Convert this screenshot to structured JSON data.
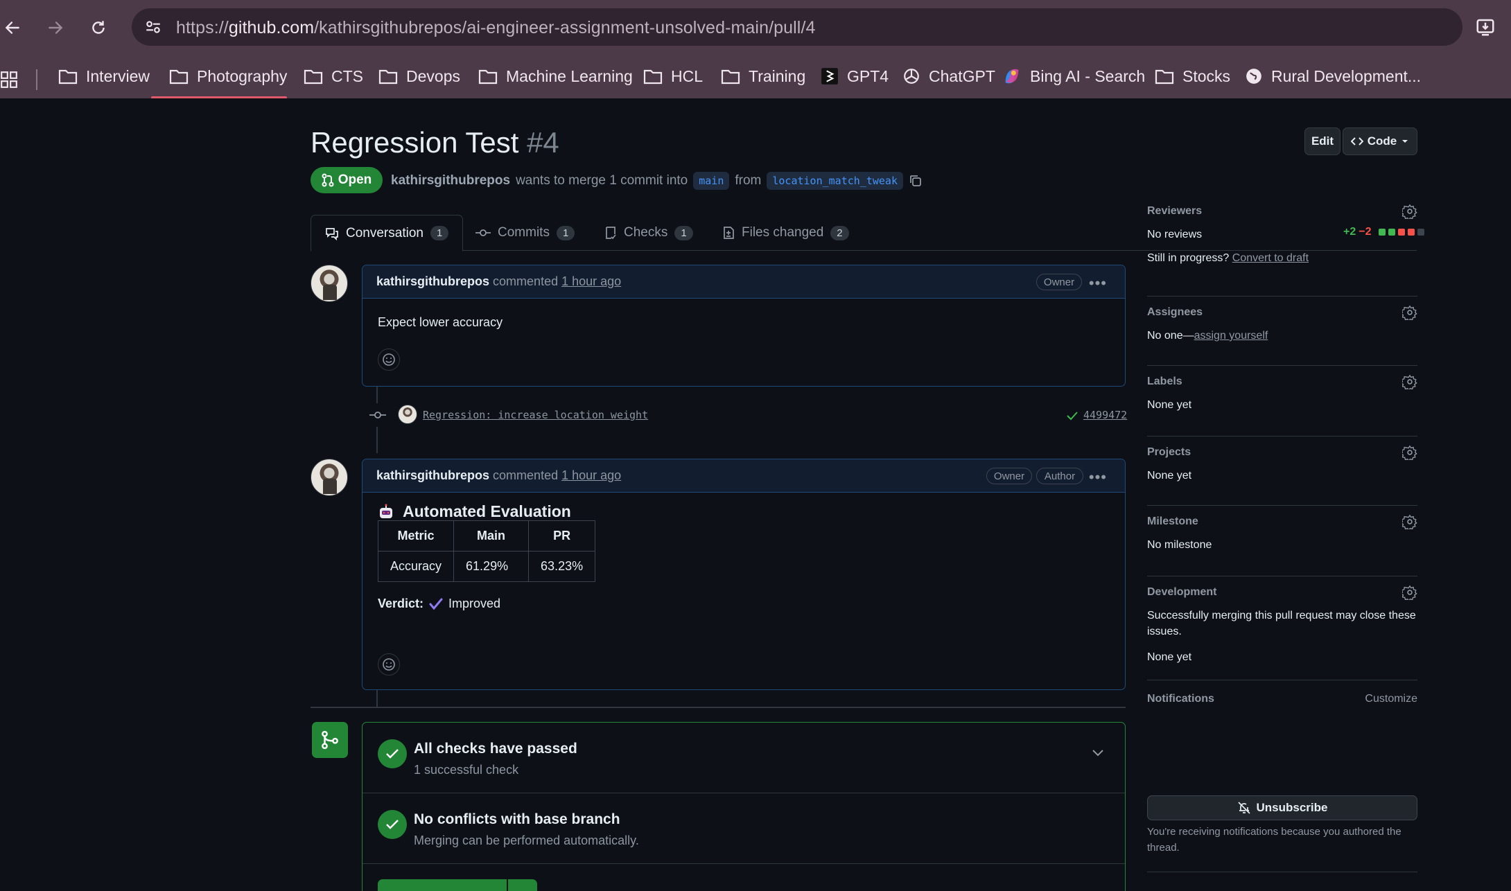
{
  "browser": {
    "url_prefix": "https://",
    "url_host": "github.com",
    "url_path": "/kathirsgithubrepos/ai-engineer-assignment-unsolved-main/pull/4",
    "bookmarks": [
      {
        "label": "Interview"
      },
      {
        "label": "Photography"
      },
      {
        "label": "CTS"
      },
      {
        "label": "Devops"
      },
      {
        "label": "Machine Learning"
      },
      {
        "label": "HCL"
      },
      {
        "label": "Training"
      },
      {
        "label": "GPT4"
      },
      {
        "label": "ChatGPT"
      },
      {
        "label": "Bing AI - Search"
      },
      {
        "label": "Stocks"
      },
      {
        "label": "Rural Development..."
      }
    ]
  },
  "pr": {
    "title": "Regression Test",
    "number": "#4",
    "edit_label": "Edit",
    "code_label": "Code",
    "state": "Open",
    "author": "kathirsgithubrepos",
    "merge_text": "wants to merge 1 commit into",
    "base_branch": "main",
    "from_text": "from",
    "head_branch": "location_match_tweak"
  },
  "tabs": [
    {
      "label": "Conversation",
      "count": "1"
    },
    {
      "label": "Commits",
      "count": "1"
    },
    {
      "label": "Checks",
      "count": "1"
    },
    {
      "label": "Files changed",
      "count": "2"
    }
  ],
  "diffstat": {
    "additions": "+2",
    "deletions": "−2",
    "add_color": "#3fb950",
    "del_color": "#f85149"
  },
  "comments": [
    {
      "author": "kathirsgithubrepos",
      "action": "commented",
      "time": "1 hour ago",
      "role": "Owner",
      "body": "Expect lower accuracy"
    },
    {
      "author": "kathirsgithubrepos",
      "action": "commented",
      "time": "1 hour ago",
      "role": "Owner",
      "role2": "Author",
      "heading": "Automated Evaluation",
      "table": {
        "headers": [
          "Metric",
          "Main",
          "PR"
        ],
        "rows": [
          [
            "Accuracy",
            "61.29%",
            "63.23%"
          ]
        ]
      },
      "verdict_label": "Verdict:",
      "verdict": "Improved"
    }
  ],
  "commit": {
    "message": "Regression: increase location weight",
    "sha": "4499472"
  },
  "merge_box": {
    "checks_title": "All checks have passed",
    "checks_sub": "1 successful check",
    "conflicts_title": "No conflicts with base branch",
    "conflicts_sub": "Merging can be performed automatically."
  },
  "sidebar": {
    "reviewers": {
      "title": "Reviewers",
      "value": "No reviews",
      "progress": "Still in progress?",
      "draft_link": "Convert to draft"
    },
    "assignees": {
      "title": "Assignees",
      "value": "No one—",
      "link": "assign yourself"
    },
    "labels": {
      "title": "Labels",
      "value": "None yet"
    },
    "projects": {
      "title": "Projects",
      "value": "None yet"
    },
    "milestone": {
      "title": "Milestone",
      "value": "No milestone"
    },
    "development": {
      "title": "Development",
      "desc_1": "Successfully merging this pull request may close these",
      "desc_2": "issues.",
      "value": "None yet"
    },
    "notifications": {
      "title": "Notifications",
      "customize": "Customize",
      "button": "Unsubscribe",
      "note_1": "You're receiving notifications because you authored the",
      "note_2": "thread."
    }
  },
  "colors": {
    "accent_green": "#238636",
    "link_blue": "#4493f8",
    "chrome_bg": "#4d3a49"
  }
}
